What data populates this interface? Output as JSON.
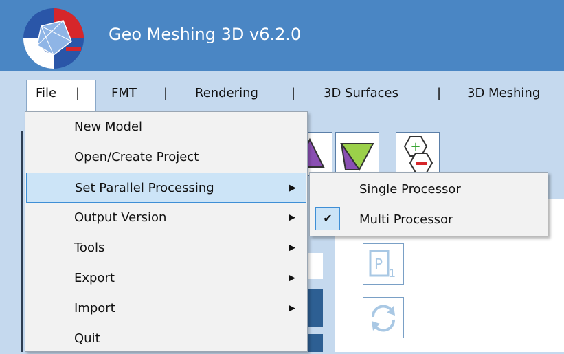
{
  "window": {
    "title": "Geo Meshing 3D v6.2.0",
    "logo_icon": "geo-meshing-logo-icon"
  },
  "menubar": {
    "items": [
      {
        "label": "File"
      },
      {
        "label": "FMT"
      },
      {
        "label": "Rendering"
      },
      {
        "label": "3D Surfaces"
      },
      {
        "label": "3D Meshing"
      }
    ],
    "separator": "|"
  },
  "file_menu": {
    "items": [
      {
        "label": "New Model",
        "has_submenu": false
      },
      {
        "label": "Open/Create Project",
        "has_submenu": false
      },
      {
        "label": "Set Parallel Processing",
        "has_submenu": true,
        "highlighted": true
      },
      {
        "label": "Output Version",
        "has_submenu": true
      },
      {
        "label": "Tools",
        "has_submenu": true
      },
      {
        "label": "Export",
        "has_submenu": true
      },
      {
        "label": "Import",
        "has_submenu": true
      },
      {
        "label": "Quit",
        "has_submenu": false
      }
    ],
    "submenu_arrow": "▶"
  },
  "parallel_submenu": {
    "items": [
      {
        "label": "Single Processor",
        "checked": false
      },
      {
        "label": "Multi Processor",
        "checked": true
      }
    ],
    "check_mark": "✔"
  },
  "colors": {
    "titlebar": "#4a86c4",
    "background": "#c5d9ee",
    "menu_highlight": "#cce4f7",
    "menu_highlight_border": "#3f8fd6"
  }
}
